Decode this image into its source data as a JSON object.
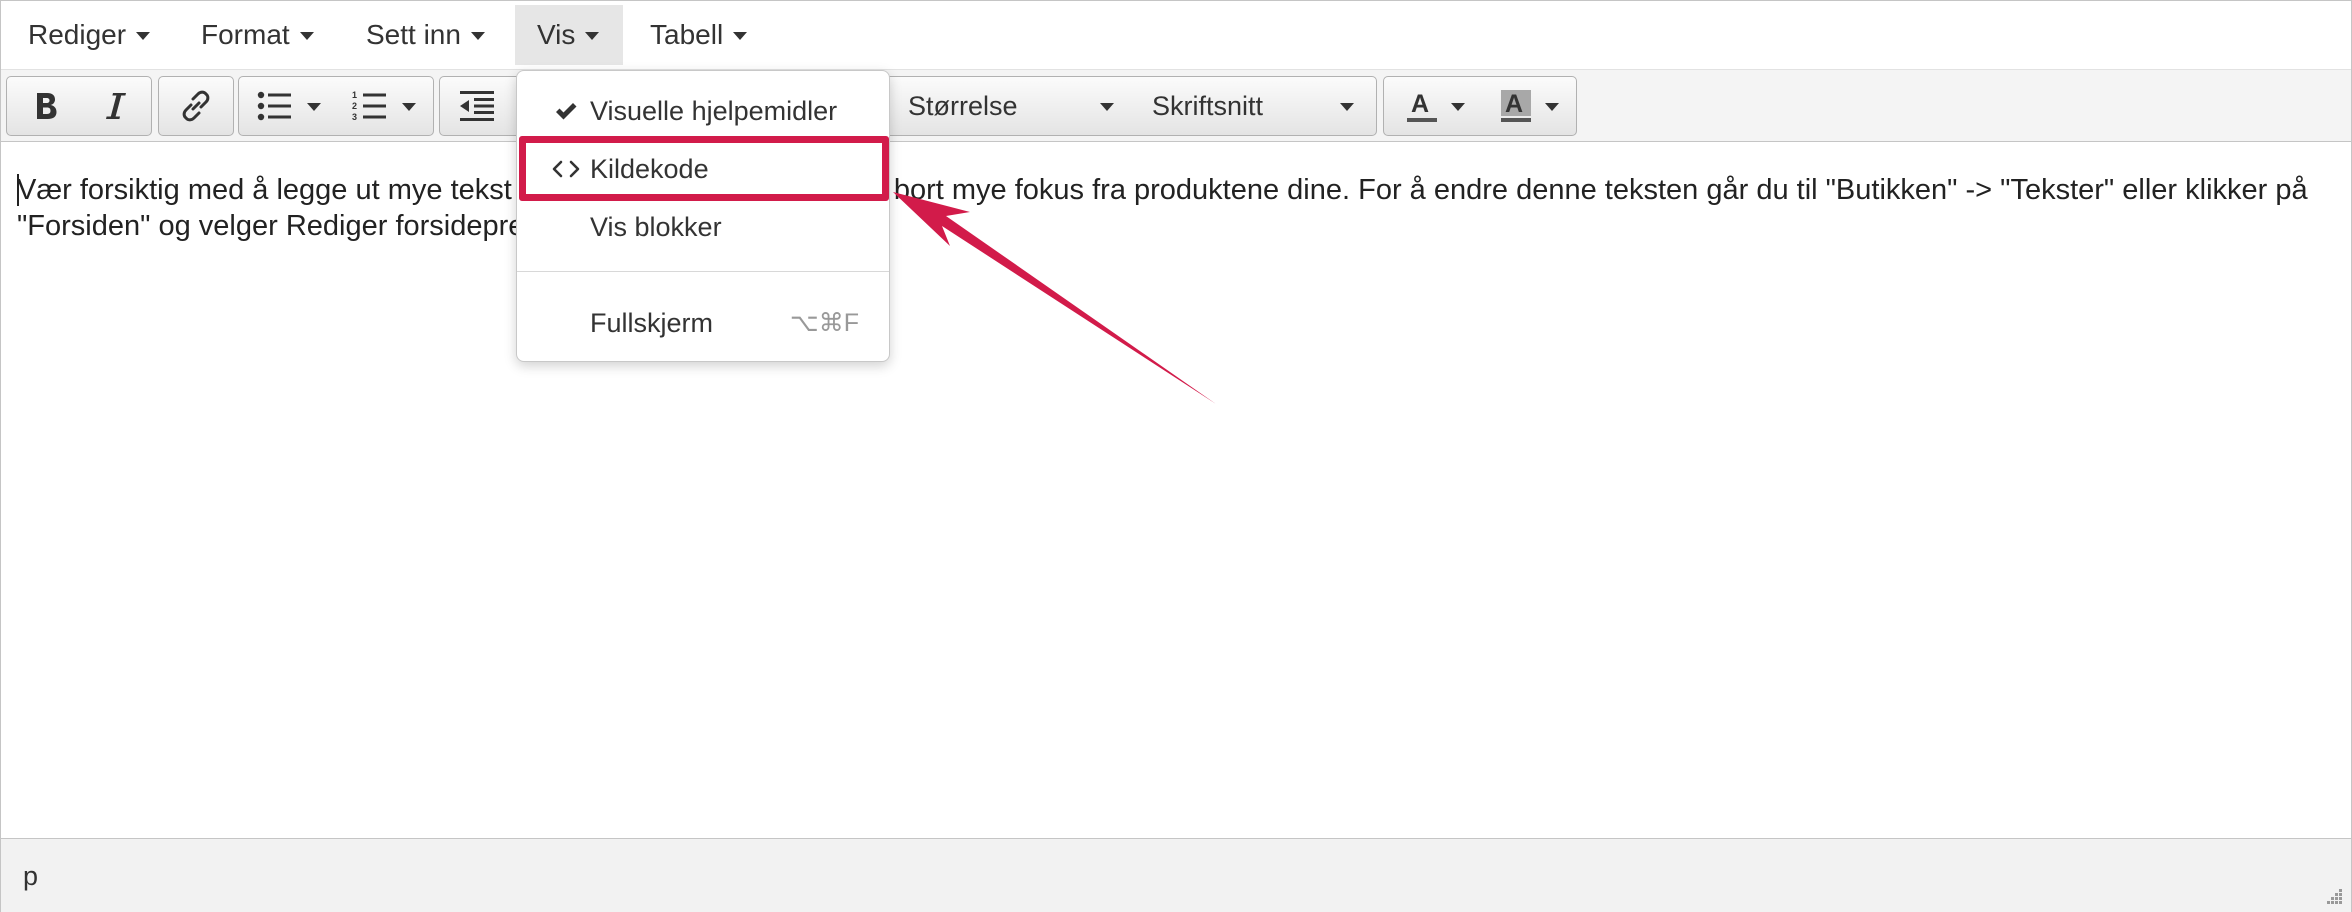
{
  "menubar": {
    "items": [
      {
        "label": "Rediger"
      },
      {
        "label": "Format"
      },
      {
        "label": "Sett inn"
      },
      {
        "label": "Vis"
      },
      {
        "label": "Tabell"
      }
    ]
  },
  "toolbar": {
    "size_select": "Størrelse",
    "font_select": "Skriftsnitt"
  },
  "content": {
    "text": "Vær forsiktig med å legge ut mye tekst her på forsiden. Dette kan ta bort mye fokus fra produktene dine. For å endre denne teksten går du til \"Butikken\" -> \"Tekster\" eller klikker på \"Forsiden\" og velger Rediger forsidepresentasjonen."
  },
  "dropdown": {
    "items": [
      {
        "label": "Visuelle hjelpemidler",
        "icon": "checkmark-icon",
        "checked": true
      },
      {
        "label": "Kildekode",
        "icon": "code-icon"
      },
      {
        "label": "Vis blokker",
        "icon": ""
      },
      {
        "label": "Fullskjerm",
        "icon": "",
        "shortcut": "⌥⌘F"
      }
    ]
  },
  "statusbar": {
    "path": "p"
  },
  "colors": {
    "annotation": "#d21b4a",
    "menu_active_bg": "#e6e6e6"
  }
}
